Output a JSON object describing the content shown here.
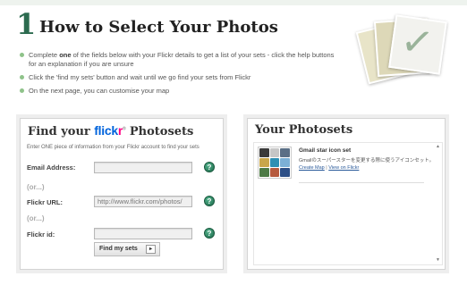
{
  "header": {
    "step_number": "1",
    "title": "How to Select Your Photos"
  },
  "instructions": [
    {
      "pre": "Complete ",
      "bold": "one",
      "post": " of the fields below with your Flickr details to get a list of your sets - click the help buttons for an explanation if you are unsure"
    },
    {
      "pre": "Click the 'find my sets' button and wait until we go find your sets from Flickr",
      "bold": "",
      "post": ""
    },
    {
      "pre": "On the next page, you can customise your map",
      "bold": "",
      "post": ""
    }
  ],
  "find_panel": {
    "title_prefix": "Find your",
    "logo_part1": "flick",
    "logo_part2": "r",
    "logo_mark": "®",
    "title_suffix": "Photosets",
    "description": "Enter ONE piece of information from your Flickr account to find your sets",
    "fields": [
      {
        "label": "Email Address:",
        "value": "",
        "placeholder": ""
      },
      {
        "label": "Flickr URL:",
        "value": "http://www.flickr.com/photos/",
        "placeholder": ""
      },
      {
        "label": "Flickr id:",
        "value": "",
        "placeholder": ""
      }
    ],
    "or_label": "(or...)",
    "help_icon": "?",
    "submit_label": "Find my sets",
    "submit_icon": "▸"
  },
  "photosets_panel": {
    "title": "Your Photosets",
    "sets": [
      {
        "name": "Gmail star icon set",
        "description": "Gmailのスーパースターを変更する際に使うアイコンセット。",
        "create_map": "Create Map",
        "separator": "|",
        "view_on_flickr": "View on Flickr"
      }
    ],
    "scroll_up": "▲",
    "scroll_down": "▼"
  },
  "colors": {
    "accent_green": "#2c6b4f",
    "bullet": "#8fc38a",
    "flickr_blue": "#0063dc",
    "flickr_pink": "#ff0084",
    "link": "#2a5a9a"
  }
}
